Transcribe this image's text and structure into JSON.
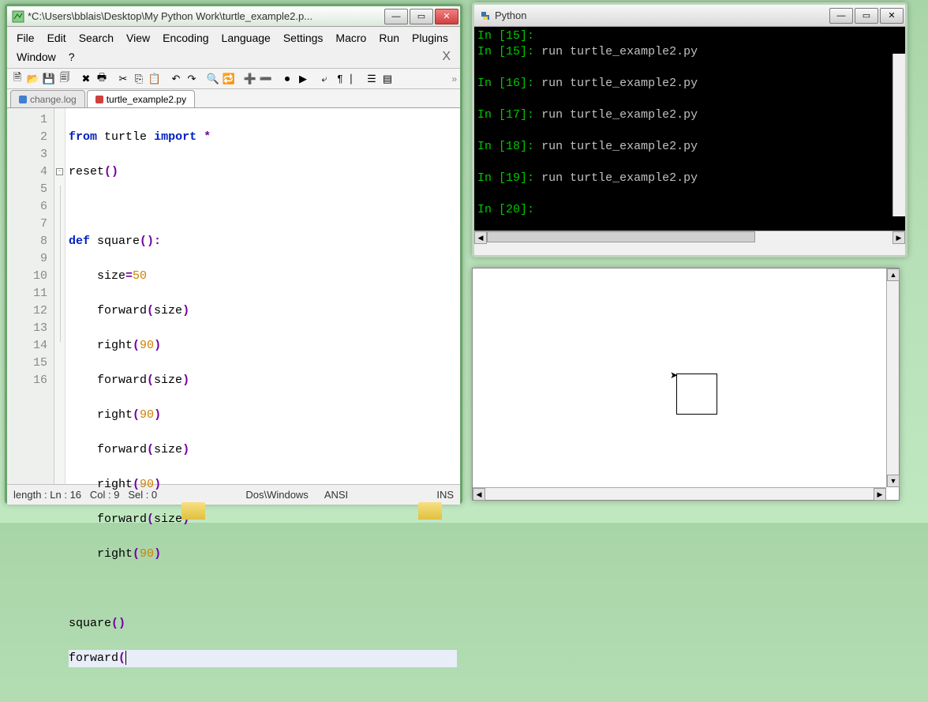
{
  "editor": {
    "title": "*C:\\Users\\bblais\\Desktop\\My Python Work\\turtle_example2.p...",
    "menus": [
      "File",
      "Edit",
      "Search",
      "View",
      "Encoding",
      "Language",
      "Settings",
      "Macro",
      "Run",
      "Plugins",
      "Window",
      "?"
    ],
    "close_x": "X",
    "tabs": [
      {
        "label": "change.log",
        "active": false,
        "dot": "blue"
      },
      {
        "label": "turtle_example2.py",
        "active": true,
        "dot": "red"
      }
    ],
    "lines": [
      1,
      2,
      3,
      4,
      5,
      6,
      7,
      8,
      9,
      10,
      11,
      12,
      13,
      14,
      15,
      16
    ],
    "current_line": 16,
    "status": {
      "len": "length :",
      "ln": "Ln : 16",
      "col": "Col : 9",
      "sel": "Sel : 0",
      "eol": "Dos\\Windows",
      "enc": "ANSI",
      "mode": "INS"
    }
  },
  "console": {
    "title": "Python",
    "rows": [
      {
        "n": "15",
        "cmd": ""
      },
      {
        "n": "15",
        "cmd": "run turtle_example2.py"
      },
      {
        "n": "16",
        "cmd": "run turtle_example2.py"
      },
      {
        "n": "17",
        "cmd": "run turtle_example2.py"
      },
      {
        "n": "18",
        "cmd": "run turtle_example2.py"
      },
      {
        "n": "19",
        "cmd": "run turtle_example2.py"
      },
      {
        "n": "20",
        "cmd": ""
      }
    ]
  },
  "code_tokens": {
    "from": "from",
    "turtle": "turtle",
    "import": "import",
    "star": "*",
    "reset": "reset",
    "def": "def",
    "square": "square",
    "size": "size",
    "eq": "=",
    "fifty": "50",
    "forward": "forward",
    "right": "right",
    "ninety": "90"
  }
}
